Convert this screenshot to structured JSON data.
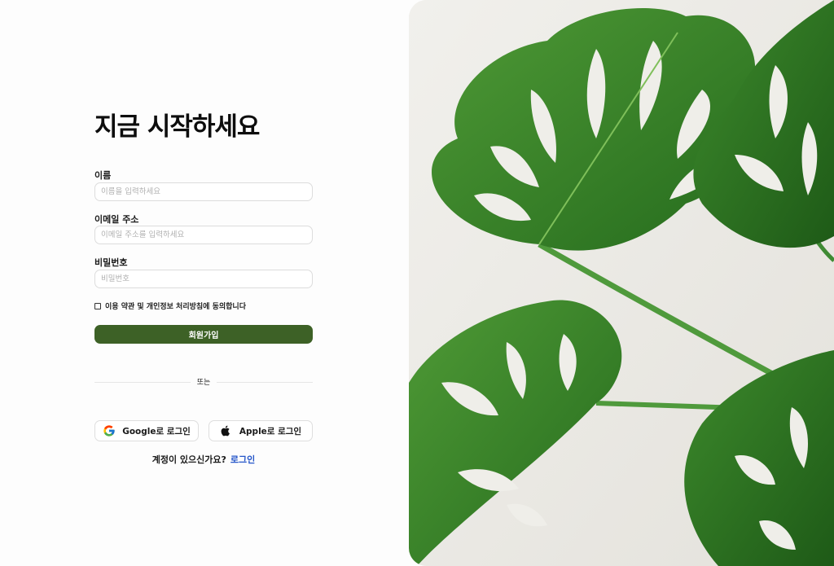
{
  "signup": {
    "title": "지금 시작하세요",
    "name": {
      "label": "이름",
      "placeholder": "이름을 입력하세요",
      "value": ""
    },
    "email": {
      "label": "이메일 주소",
      "placeholder": "이메일 주소를 입력하세요",
      "value": ""
    },
    "password": {
      "label": "비밀번호",
      "placeholder": "비밀번호",
      "value": ""
    },
    "terms_label": "이용 약관 및 개인정보 처리방침에 동의합니다",
    "terms_checked": false,
    "submit_label": "회원가입",
    "divider_text": "또는",
    "google_label": "Google로 로그인",
    "apple_label": "Apple로 로그인",
    "login_prompt": "계정이 있으신가요?",
    "login_link": "로그인"
  },
  "icons": {
    "google": "google-icon",
    "apple": "apple-icon"
  },
  "colors": {
    "accent": "#3d6126",
    "link": "#2556c9",
    "background": "#fdfdfd",
    "leaf": "#3f7d2b"
  }
}
